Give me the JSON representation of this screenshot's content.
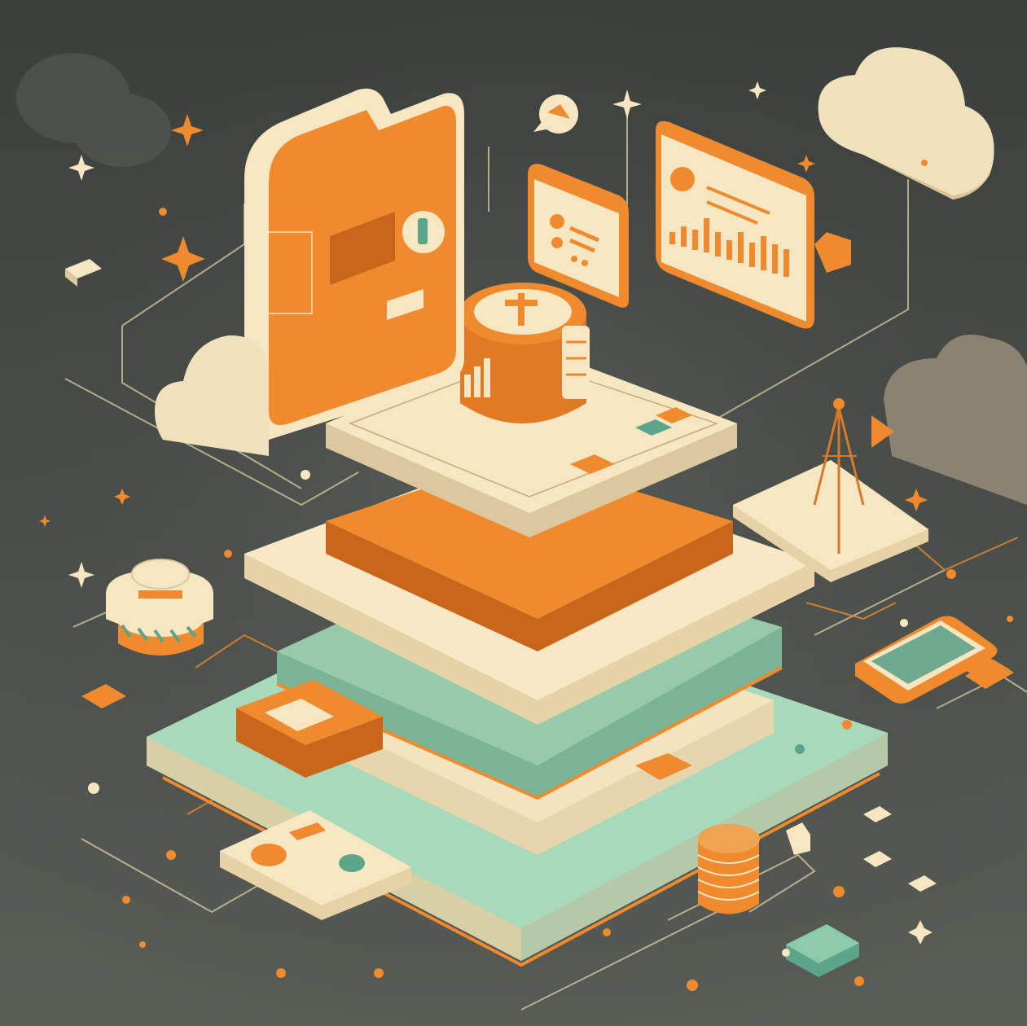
{
  "illustration": {
    "subject": "isometric-cloud-data-infrastructure",
    "palette": {
      "background_top": "#3f433f",
      "background_bottom": "#5a5e58",
      "orange": "#ef8a2e",
      "orange_dark": "#c9661c",
      "cream": "#f6e6c2",
      "cream_shadow": "#dcc89e",
      "mint": "#a9d9bb",
      "mint_dark": "#7bb395",
      "teal": "#5aa58b",
      "grey_cloud": "#8a8374",
      "line": "#e8dcc0"
    },
    "elements": [
      "folder-panel",
      "database-cylinder",
      "dashboard-bar-chart-panel",
      "speech-bubble-icon",
      "card-panel",
      "cloud-icon",
      "antenna-tower",
      "smartphone-device",
      "coin-stack",
      "server-stack-layers",
      "sparkle-icon"
    ]
  }
}
